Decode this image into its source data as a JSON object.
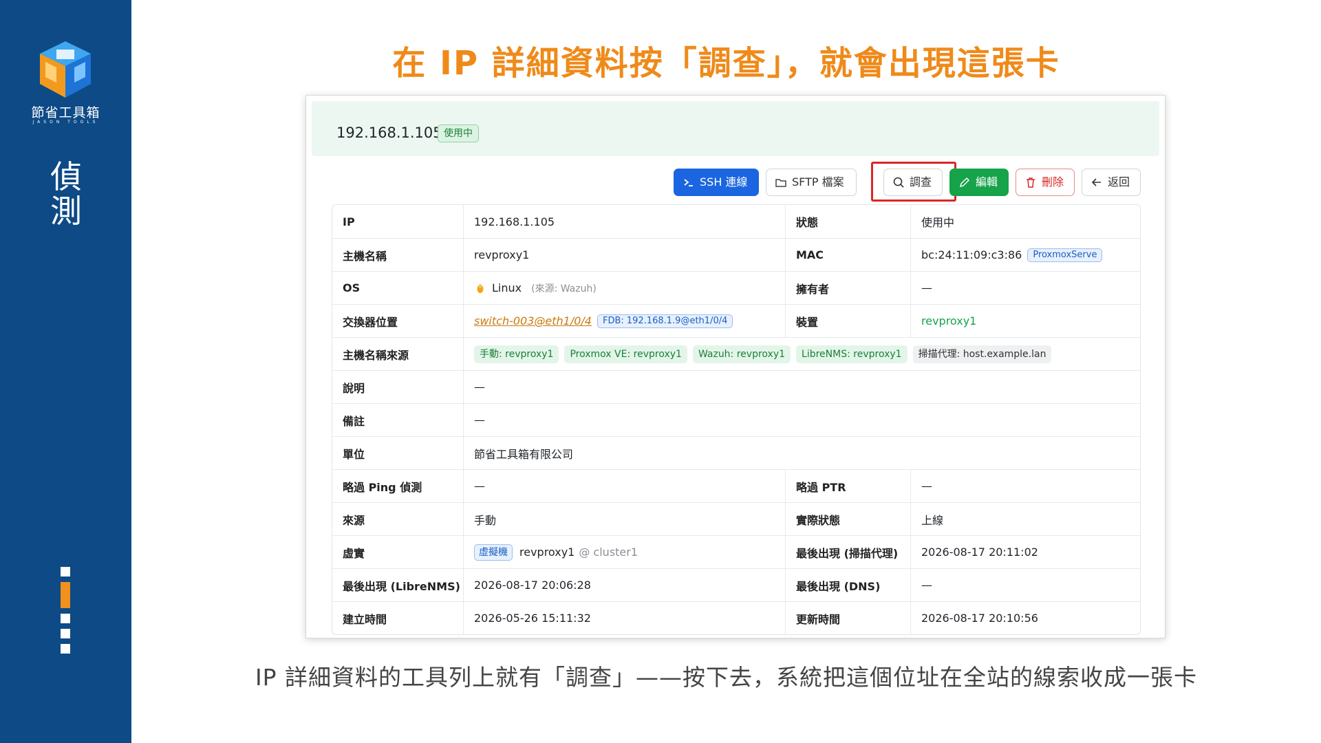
{
  "sidebar": {
    "brand_name": "節省工具箱",
    "brand_sub": "JASON TOOLS",
    "section_title": "偵測",
    "progress_total": 5,
    "progress_active_index": 1
  },
  "heading": "在 IP 詳細資料按「調查」，就會出現這張卡",
  "card": {
    "ip": "192.168.1.105",
    "status_badge": "使用中",
    "toolbar": {
      "ssh": "SSH 連線",
      "sftp": "SFTP 檔案",
      "investigate": "調查",
      "edit": "編輯",
      "delete": "刪除",
      "back": "返回"
    },
    "rows": {
      "ip": {
        "label": "IP",
        "value": "192.168.1.105",
        "label2": "狀態",
        "value2": "使用中"
      },
      "hostname": {
        "label": "主機名稱",
        "value": "revproxy1",
        "label2": "MAC",
        "value2": "bc:24:11:09:c3:86",
        "value2_tag": "ProxmoxServe"
      },
      "os": {
        "label": "OS",
        "value": "Linux",
        "value_note": "(來源: Wazuh)",
        "label2": "擁有者",
        "value2": "—"
      },
      "switch": {
        "label": "交換器位置",
        "value": "switch-003@eth1/0/4",
        "value_tag": "FDB: 192.168.1.9@eth1/0/4",
        "label2": "裝置",
        "value2": "revproxy1"
      },
      "hostname_src": {
        "label": "主機名稱來源",
        "tags": [
          "手動: revproxy1",
          "Proxmox VE: revproxy1",
          "Wazuh: revproxy1",
          "LibreNMS: revproxy1",
          "掃描代理: host.example.lan"
        ]
      },
      "desc": {
        "label": "說明",
        "value": "—"
      },
      "note": {
        "label": "備註",
        "value": "—"
      },
      "unit": {
        "label": "單位",
        "value": "節省工具箱有限公司"
      },
      "skip_ping": {
        "label": "略過 Ping 偵測",
        "value": "—",
        "label2": "略過 PTR",
        "value2": "—"
      },
      "source": {
        "label": "來源",
        "value": "手動",
        "label2": "實際狀態",
        "value2": "上線"
      },
      "virtual": {
        "label": "虛實",
        "value_tag": "虛擬機",
        "value": "revproxy1",
        "value_suffix": "@ cluster1",
        "label2": "最後出現 (掃描代理)",
        "value2": "2026-08-17 20:11:02"
      },
      "last_librenms": {
        "label": "最後出現 (LibreNMS)",
        "value": "2026-08-17 20:06:28",
        "label2": "最後出現 (DNS)",
        "value2": "—"
      },
      "created": {
        "label": "建立時間",
        "value": "2026-05-26 15:11:32",
        "label2": "更新時間",
        "value2": "2026-08-17 20:10:56"
      }
    }
  },
  "caption": "IP 詳細資料的工具列上就有「調查」——按下去，系統把這個位址在全站的線索收成一張卡",
  "colors": {
    "sidebar_bg": "#0d4a86",
    "accent_orange": "#ef8a1a",
    "primary_blue": "#1b66e0",
    "success_green": "#16a34a",
    "danger_red": "#dc2626",
    "highlight_red": "#d92626"
  }
}
